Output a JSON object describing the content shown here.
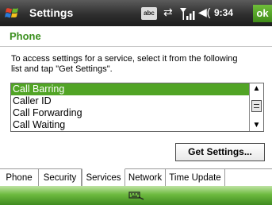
{
  "titlebar": {
    "title": "Settings",
    "time": "9:34",
    "ok_label": "ok",
    "ime_label": "abc"
  },
  "page": {
    "title": "Phone"
  },
  "instructions": "To access settings for a service, select it from the following list and tap \"Get Settings\".",
  "services": {
    "items": [
      "Call Barring",
      "Caller ID",
      "Call Forwarding",
      "Call Waiting"
    ],
    "selected_index": 0
  },
  "get_settings_label": "Get Settings...",
  "tabs": [
    {
      "label": "Phone",
      "active": false
    },
    {
      "label": "Security",
      "active": false
    },
    {
      "label": "Services",
      "active": true
    },
    {
      "label": "Network",
      "active": false
    },
    {
      "label": "Time Update",
      "active": false
    }
  ],
  "colors": {
    "accent": "#3b8f1e",
    "selection": "#51a425"
  },
  "icons": {
    "start": "windows-flag-icon",
    "sync": "connectivity-icon",
    "signal": "signal-strength-icon",
    "volume": "speaker-icon",
    "keyboard": "keyboard-icon"
  }
}
